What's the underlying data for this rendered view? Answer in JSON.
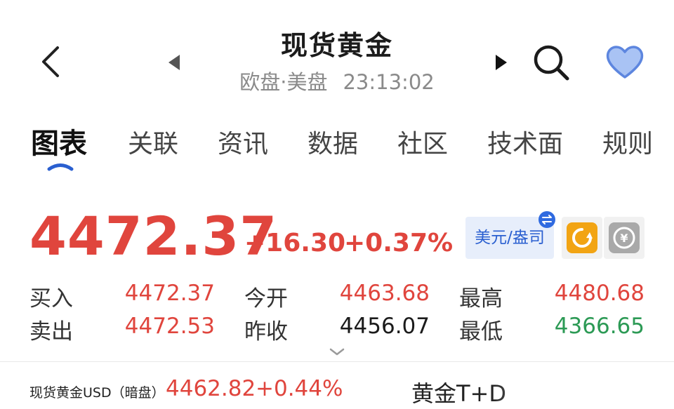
{
  "header": {
    "title": "现货黄金",
    "session": "欧盘·美盘",
    "time": "23:13:02",
    "icons": [
      "back-icon",
      "prev-icon",
      "next-icon",
      "search-icon",
      "heart-icon"
    ]
  },
  "tabs": [
    {
      "label": "图表",
      "active": true
    },
    {
      "label": "关联"
    },
    {
      "label": "资讯"
    },
    {
      "label": "数据"
    },
    {
      "label": "社区"
    },
    {
      "label": "技术面"
    },
    {
      "label": "规则"
    }
  ],
  "quote": {
    "price": "4472.37",
    "change": "+16.30",
    "change_pct": "+0.37%",
    "unit_label": "美元/盎司",
    "bid_label": "买入",
    "bid": "4472.37",
    "ask_label": "卖出",
    "ask": "4472.53",
    "open_label": "今开",
    "open": "4463.68",
    "prev_close_label": "昨收",
    "prev_close": "4456.07",
    "high_label": "最高",
    "high": "4480.68",
    "low_label": "最低",
    "low": "4366.65"
  },
  "bottom": {
    "night_label": "现货黄金USD（暗盘）",
    "night_price": "4462.82",
    "night_pct": "+0.44%",
    "td_label": "黄金T+D"
  },
  "colors": {
    "up": "#e0453d",
    "down": "#2c9a55",
    "accent": "#2a5fd0",
    "heart": "#7fa6ee",
    "orange": "#f2a413"
  }
}
